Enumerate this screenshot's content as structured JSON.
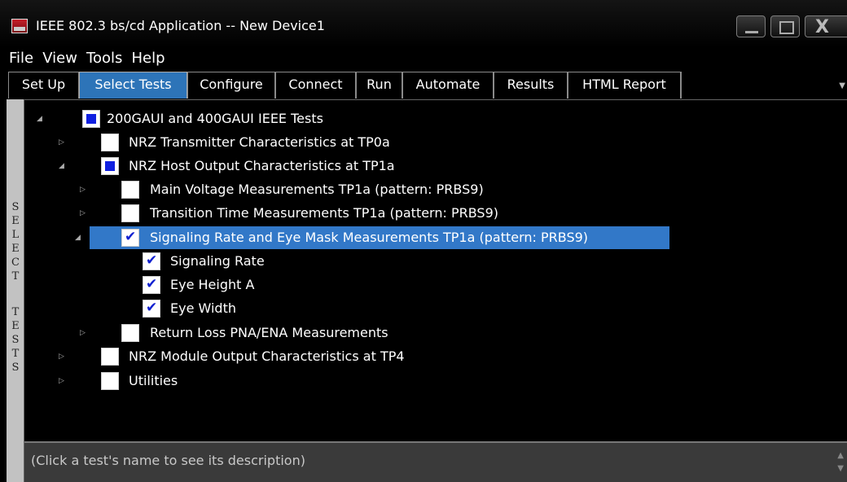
{
  "window": {
    "title": "IEEE 802.3 bs/cd Application -- New Device1"
  },
  "menu": [
    "File",
    "View",
    "Tools",
    "Help"
  ],
  "tabs": [
    "Set Up",
    "Select Tests",
    "Configure",
    "Connect",
    "Run",
    "Automate",
    "Results",
    "HTML Report"
  ],
  "active_tab": "Select Tests",
  "side_label": [
    "S",
    "E",
    "L",
    "E",
    "C",
    "T",
    "",
    "T",
    "E",
    "S",
    "T",
    "S"
  ],
  "tree": [
    {
      "label": "200GAUI and 400GAUI IEEE Tests",
      "state": "partial",
      "expanded": true
    },
    {
      "label": "NRZ Transmitter Characteristics at TP0a",
      "state": "unchecked",
      "expanded": false
    },
    {
      "label": "NRZ Host Output Characteristics at TP1a",
      "state": "partial",
      "expanded": true
    },
    {
      "label": "Main Voltage Measurements TP1a (pattern: PRBS9)",
      "state": "unchecked",
      "expanded": false
    },
    {
      "label": "Transition Time Measurements TP1a (pattern: PRBS9)",
      "state": "unchecked",
      "expanded": false
    },
    {
      "label": "Signaling Rate and Eye Mask Measurements TP1a (pattern: PRBS9)",
      "state": "checked",
      "expanded": true,
      "selected": true
    },
    {
      "label": "Signaling Rate",
      "state": "checked"
    },
    {
      "label": "Eye Height A",
      "state": "checked"
    },
    {
      "label": "Eye Width",
      "state": "checked"
    },
    {
      "label": "Return Loss PNA/ENA Measurements",
      "state": "unchecked",
      "expanded": false
    },
    {
      "label": "NRZ Module Output Characteristics at TP4",
      "state": "unchecked",
      "expanded": false
    },
    {
      "label": "Utilities",
      "state": "unchecked",
      "expanded": false
    }
  ],
  "description": {
    "placeholder": "(Click a test's name to see its description)"
  },
  "colors": {
    "active_tab": "#2d74b8",
    "selection": "#3278c8",
    "partial_fill": "#1020e0"
  }
}
